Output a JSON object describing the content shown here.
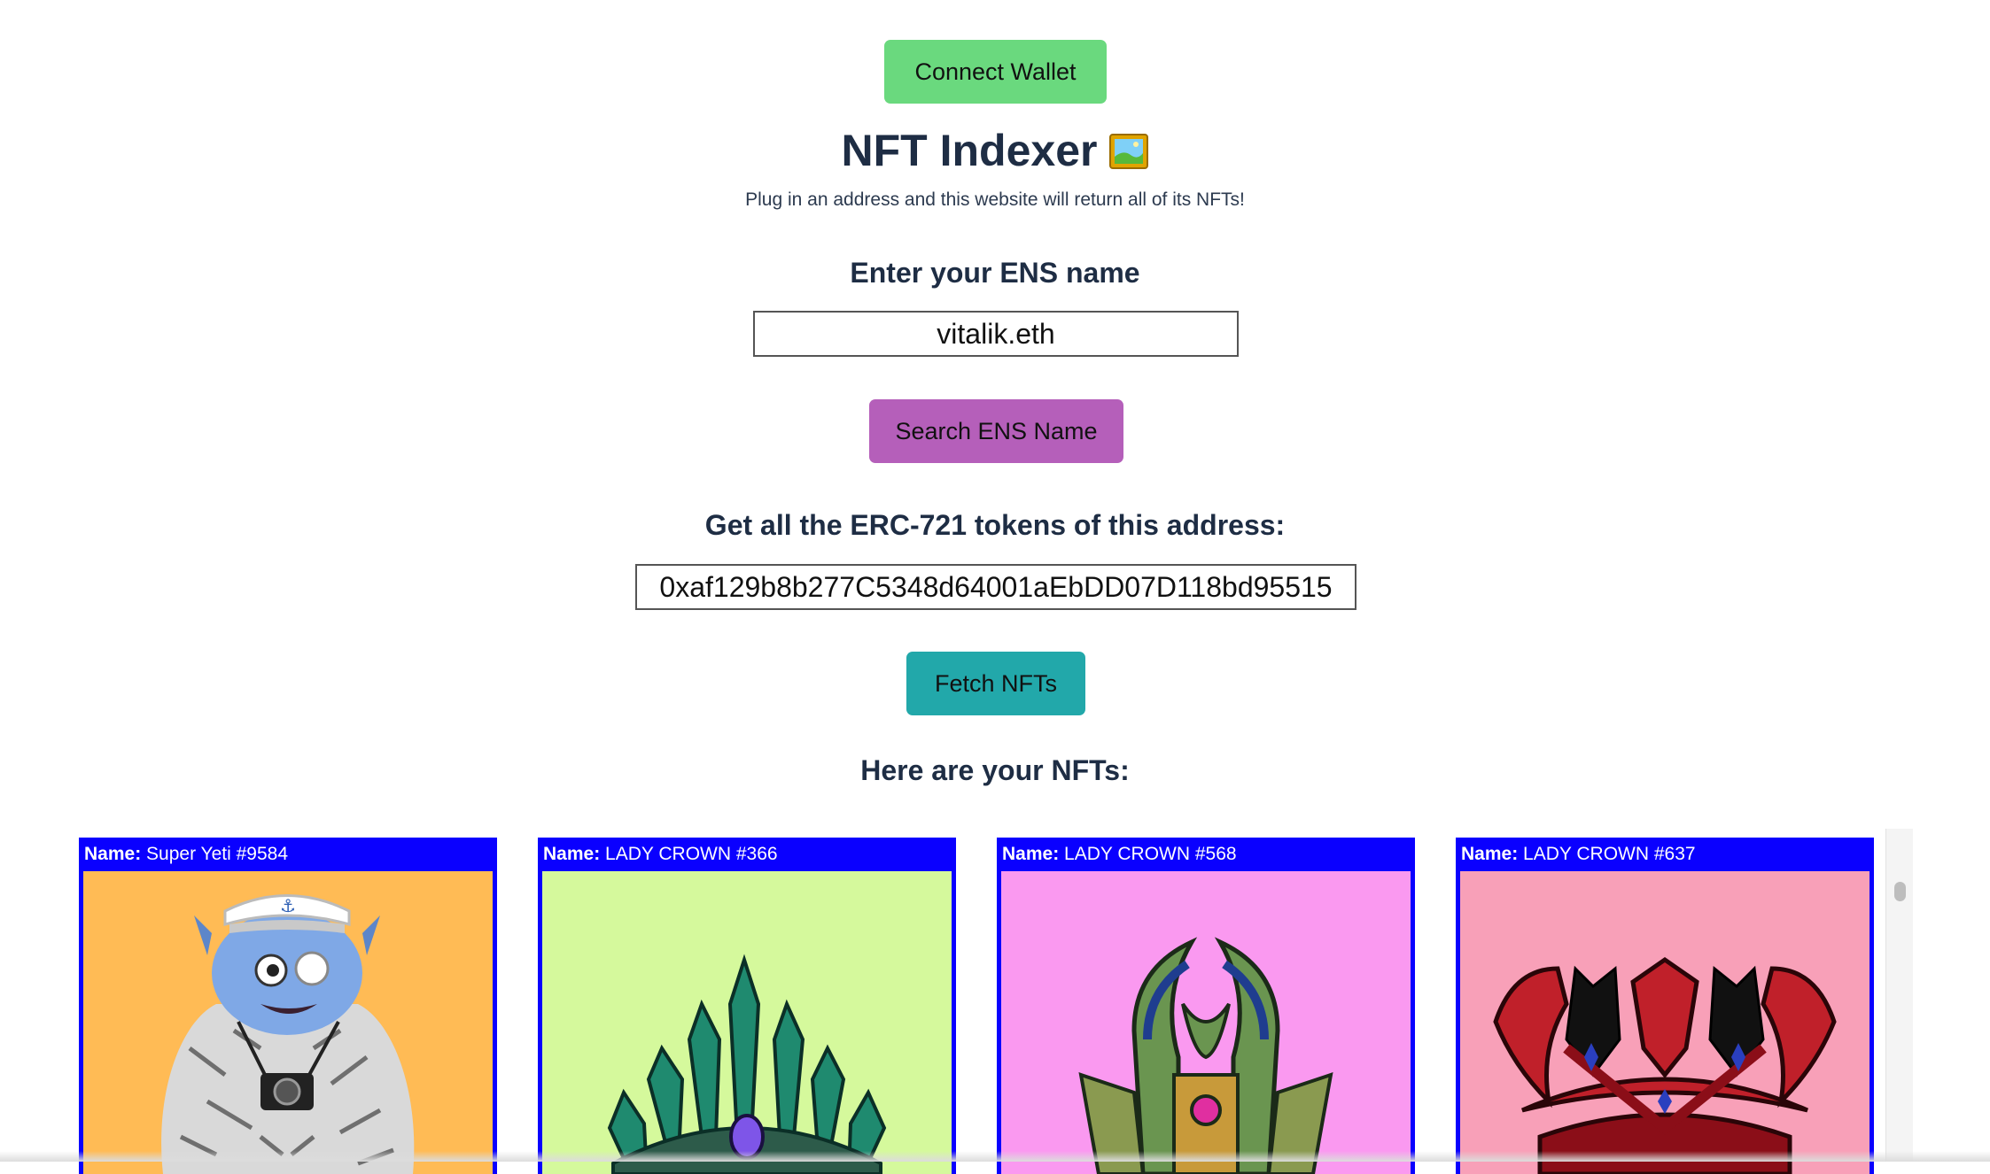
{
  "header": {
    "connect_label": "Connect Wallet",
    "title": "NFT Indexer",
    "title_icon": "framed-picture-icon",
    "subtitle": "Plug in an address and this website will return all of its NFTs!"
  },
  "ens": {
    "label": "Enter your ENS name",
    "value": "vitalik.eth",
    "button_label": "Search ENS Name"
  },
  "address": {
    "label": "Get all the ERC-721 tokens of this address:",
    "value": "0xaf129b8b277C5348d64001aEbDD07D118bd95515",
    "button_label": "Fetch NFTs"
  },
  "results": {
    "heading": "Here are your NFTs:",
    "name_prefix": "Name:",
    "cards": [
      {
        "name": "Super Yeti #9584",
        "bg": "#ffbb55"
      },
      {
        "name": "LADY CROWN #366",
        "bg": "#d5f99c"
      },
      {
        "name": "LADY CROWN #568",
        "bg": "#fa99f0"
      },
      {
        "name": "LADY CROWN #637",
        "bg": "#f8a0b8"
      }
    ]
  },
  "colors": {
    "connect": "#6ad97e",
    "search": "#b55fba",
    "fetch": "#22a8aa",
    "card_border": "#0a00ff"
  }
}
